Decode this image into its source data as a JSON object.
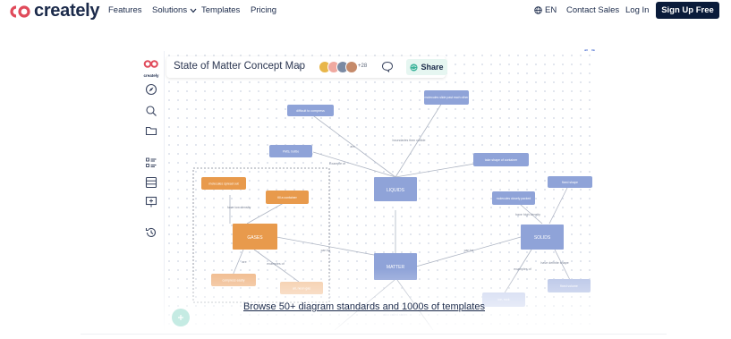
{
  "nav": {
    "logo_text": "creately",
    "links": [
      "Features",
      "Solutions",
      "Templates",
      "Pricing"
    ],
    "lang": "EN",
    "contact_sales": "Contact Sales",
    "login": "Log In",
    "signup": "Sign Up Free"
  },
  "editor": {
    "rail_logo_text": "creately",
    "doc_title": "State of Matter Concept Map",
    "avatar_overflow": "+28",
    "share_label": "Share",
    "avatar_colors": [
      "#e8b64a",
      "#f0a9a0",
      "#7a8aa3",
      "#c58a6a"
    ]
  },
  "diagram": {
    "nodes": {
      "liquids": "LIQUIDS",
      "gases": "GASES",
      "matter": "MATTER",
      "solids": "SOLIDS",
      "n_top_center": "molecules slide past each other",
      "n_difficult": "difficult to compress",
      "n_take_shape": "take shape of container",
      "n_fills": "FMS, bottle",
      "n_molecule_spread": "molecules spread out",
      "n_fill_container": "fill a container",
      "n_molecules_closely": "molecules closely packed",
      "n_fixed_shape": "fixed shape",
      "n_compress_easily": "compress easily",
      "n_air": "air, neon gas",
      "n_ice": "ice, rock",
      "n_fixed_volume": "fixed volume",
      "n_bottom": "also called states"
    },
    "edge_labels": {
      "e_example_of": "Example of",
      "e_are": "are",
      "e_have_low": "have low density",
      "e_examples_of": "examples of",
      "e_can_be": "can be",
      "e_can_be2": "can be",
      "e_have_high": "have high density",
      "e_have_def": "have definite shape",
      "e_also": "are",
      "e_ex2": "examples of",
      "e_between": "boundaries then collide"
    }
  },
  "browse_link": "Browse 50+ diagram standards and 1000s of templates",
  "colors": {
    "navy": "#0a1b3a",
    "blue_node": "#8fa3d8",
    "orange_node": "#e89a4c",
    "teal": "#3bb39a"
  }
}
